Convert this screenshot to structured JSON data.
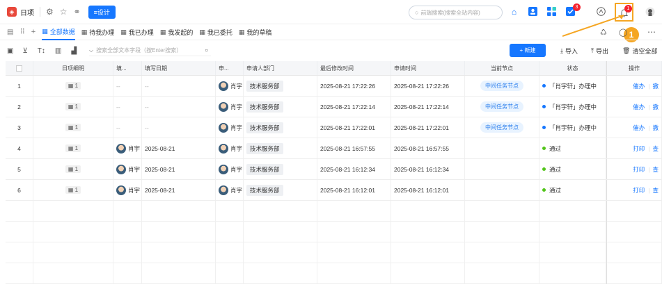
{
  "app": {
    "logo_glyph": "◈",
    "title": "日项",
    "design_label": "≡设计"
  },
  "search": {
    "placeholder": "前端搜索(搜索全站内容)"
  },
  "notifications": {
    "task_badge": "3",
    "bell_badge": "1"
  },
  "tabs": [
    {
      "label": "全部数据",
      "active": true
    },
    {
      "label": "待我办理",
      "active": false
    },
    {
      "label": "我已办理",
      "active": false
    },
    {
      "label": "我发起的",
      "active": false
    },
    {
      "label": "我已委托",
      "active": false
    },
    {
      "label": "我的草稿",
      "active": false
    }
  ],
  "toolbar": {
    "search_placeholder": "搜索全部文本字段（按Enter搜索）",
    "new_label": "+ 新建",
    "import_label": "导入",
    "export_label": "导出",
    "clear_label": "清空全部"
  },
  "table": {
    "headers": [
      "",
      "日项细明",
      "填...",
      "填写日期",
      "申...",
      "申请人部门",
      "最后修改时间",
      "申请时间",
      "当前节点",
      "状态",
      "操作"
    ],
    "rows": [
      {
        "index": "1",
        "detail": "1",
        "filler": "--",
        "fill_date": "--",
        "applicant": "肖宇",
        "dept": "技术服务部",
        "modified": "2025-08-21 17:22:26",
        "applied": "2025-08-21 17:22:26",
        "node": "中间任务节点",
        "status": "「肖宇轩」办理中",
        "status_color": "#1677ff",
        "action1": "催办",
        "action2": "撤"
      },
      {
        "index": "2",
        "detail": "1",
        "filler": "--",
        "fill_date": "--",
        "applicant": "肖宇",
        "dept": "技术服务部",
        "modified": "2025-08-21 17:22:14",
        "applied": "2025-08-21 17:22:14",
        "node": "中间任务节点",
        "status": "「肖宇轩」办理中",
        "status_color": "#1677ff",
        "action1": "催办",
        "action2": "撤"
      },
      {
        "index": "3",
        "detail": "1",
        "filler": "--",
        "fill_date": "--",
        "applicant": "肖宇",
        "dept": "技术服务部",
        "modified": "2025-08-21 17:22:01",
        "applied": "2025-08-21 17:22:01",
        "node": "中间任务节点",
        "status": "「肖宇轩」办理中",
        "status_color": "#1677ff",
        "action1": "催办",
        "action2": "撤"
      },
      {
        "index": "4",
        "detail": "1",
        "filler": "肖宇",
        "fill_date": "2025-08-21",
        "applicant": "肖宇",
        "dept": "技术服务部",
        "modified": "2025-08-21 16:57:55",
        "applied": "2025-08-21 16:57:55",
        "node": "",
        "status": "通过",
        "status_color": "#52c41a",
        "action1": "打印",
        "action2": "查"
      },
      {
        "index": "5",
        "detail": "1",
        "filler": "肖宇",
        "fill_date": "2025-08-21",
        "applicant": "肖宇",
        "dept": "技术服务部",
        "modified": "2025-08-21 16:12:34",
        "applied": "2025-08-21 16:12:34",
        "node": "",
        "status": "通过",
        "status_color": "#52c41a",
        "action1": "打印",
        "action2": "查"
      },
      {
        "index": "6",
        "detail": "1",
        "filler": "肖宇",
        "fill_date": "2025-08-21",
        "applicant": "肖宇",
        "dept": "技术服务部",
        "modified": "2025-08-21 16:12:01",
        "applied": "2025-08-21 16:12:01",
        "node": "",
        "status": "通过",
        "status_color": "#52c41a",
        "action1": "打印",
        "action2": "查"
      }
    ]
  },
  "annotation": {
    "number": "1",
    "color": "#f5a623"
  }
}
